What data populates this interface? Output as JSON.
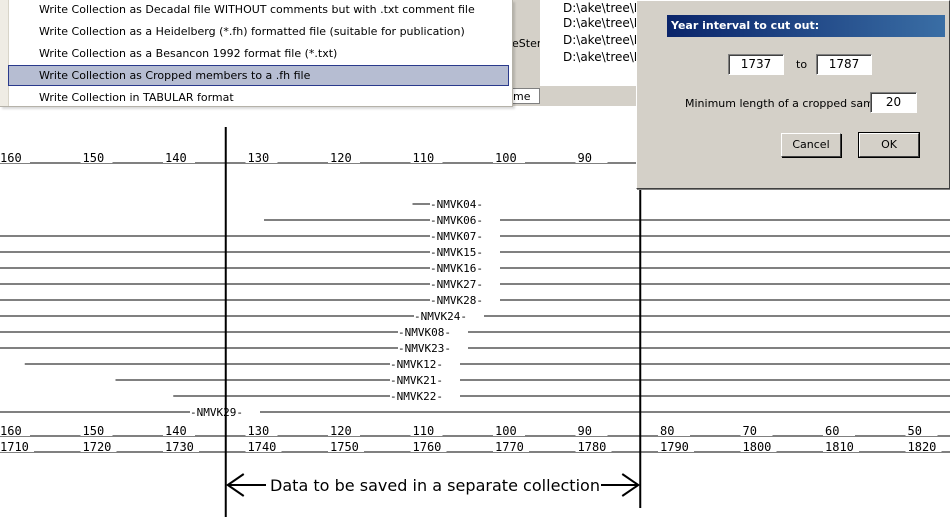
{
  "menu": {
    "items": [
      {
        "label": "Write Collection as Decadal file WITHOUT comments but with .txt comment file",
        "selected": false
      },
      {
        "label": "Write Collection as a Heidelberg (*.fh) formatted file (suitable for publication)",
        "selected": false
      },
      {
        "label": "Write Collection as a Besancon 1992 format file (*.txt)",
        "selected": false
      },
      {
        "label": "Write Collection as Cropped members to a .fh file",
        "selected": true
      },
      {
        "label": "Write Collection in TABULAR format",
        "selected": false
      }
    ]
  },
  "background_app": {
    "paths": [
      "D:\\ake\\tree\\D",
      "D:\\ake\\tree\\D",
      "D:\\ake\\tree\\D",
      "D:\\ake\\tree\\D"
    ],
    "stem_label": "eStem",
    "tab_label": "me"
  },
  "dialog": {
    "title": "Year interval to cut out:",
    "from_value": "1737",
    "to_label": "to",
    "to_value": "1787",
    "min_length_label": "Minimum length of a cropped sample:",
    "min_length_value": "20",
    "cancel_label": "Cancel",
    "ok_label": "OK"
  },
  "chart_data": {
    "type": "timeline",
    "age_axis_top": [
      "160",
      "150",
      "140",
      "130",
      "120",
      "110",
      "100",
      "90"
    ],
    "age_axis_bottom": [
      "160",
      "150",
      "140",
      "130",
      "120",
      "110",
      "100",
      "90",
      "80",
      "70",
      "60",
      "50"
    ],
    "year_axis": [
      "1710",
      "1720",
      "1730",
      "1740",
      "1750",
      "1760",
      "1770",
      "1780",
      "1790",
      "1800",
      "1810",
      "1820"
    ],
    "cut_interval": [
      1737,
      1787
    ],
    "samples": [
      {
        "label": "NMVK04",
        "start": 1760,
        "end": 1770
      },
      {
        "label": "NMVK06",
        "start": 1742,
        "end": 1870
      },
      {
        "label": "NMVK07",
        "start": 1695,
        "end": 1870
      },
      {
        "label": "NMVK15",
        "start": 1695,
        "end": 1870
      },
      {
        "label": "NMVK16",
        "start": 1695,
        "end": 1870
      },
      {
        "label": "NMVK27",
        "start": 1695,
        "end": 1870
      },
      {
        "label": "NMVK28",
        "start": 1695,
        "end": 1870
      },
      {
        "label": "NMVK24",
        "start": 1695,
        "end": 1870
      },
      {
        "label": "NMVK08",
        "start": 1695,
        "end": 1870
      },
      {
        "label": "NMVK23",
        "start": 1695,
        "end": 1870
      },
      {
        "label": "NMVK12",
        "start": 1713,
        "end": 1870
      },
      {
        "label": "NMVK21",
        "start": 1724,
        "end": 1870
      },
      {
        "label": "NMVK22",
        "start": 1731,
        "end": 1870
      },
      {
        "label": "NMVK29",
        "start": 1695,
        "end": 1870
      }
    ],
    "annotation": "Data to be saved in a separate collection"
  }
}
